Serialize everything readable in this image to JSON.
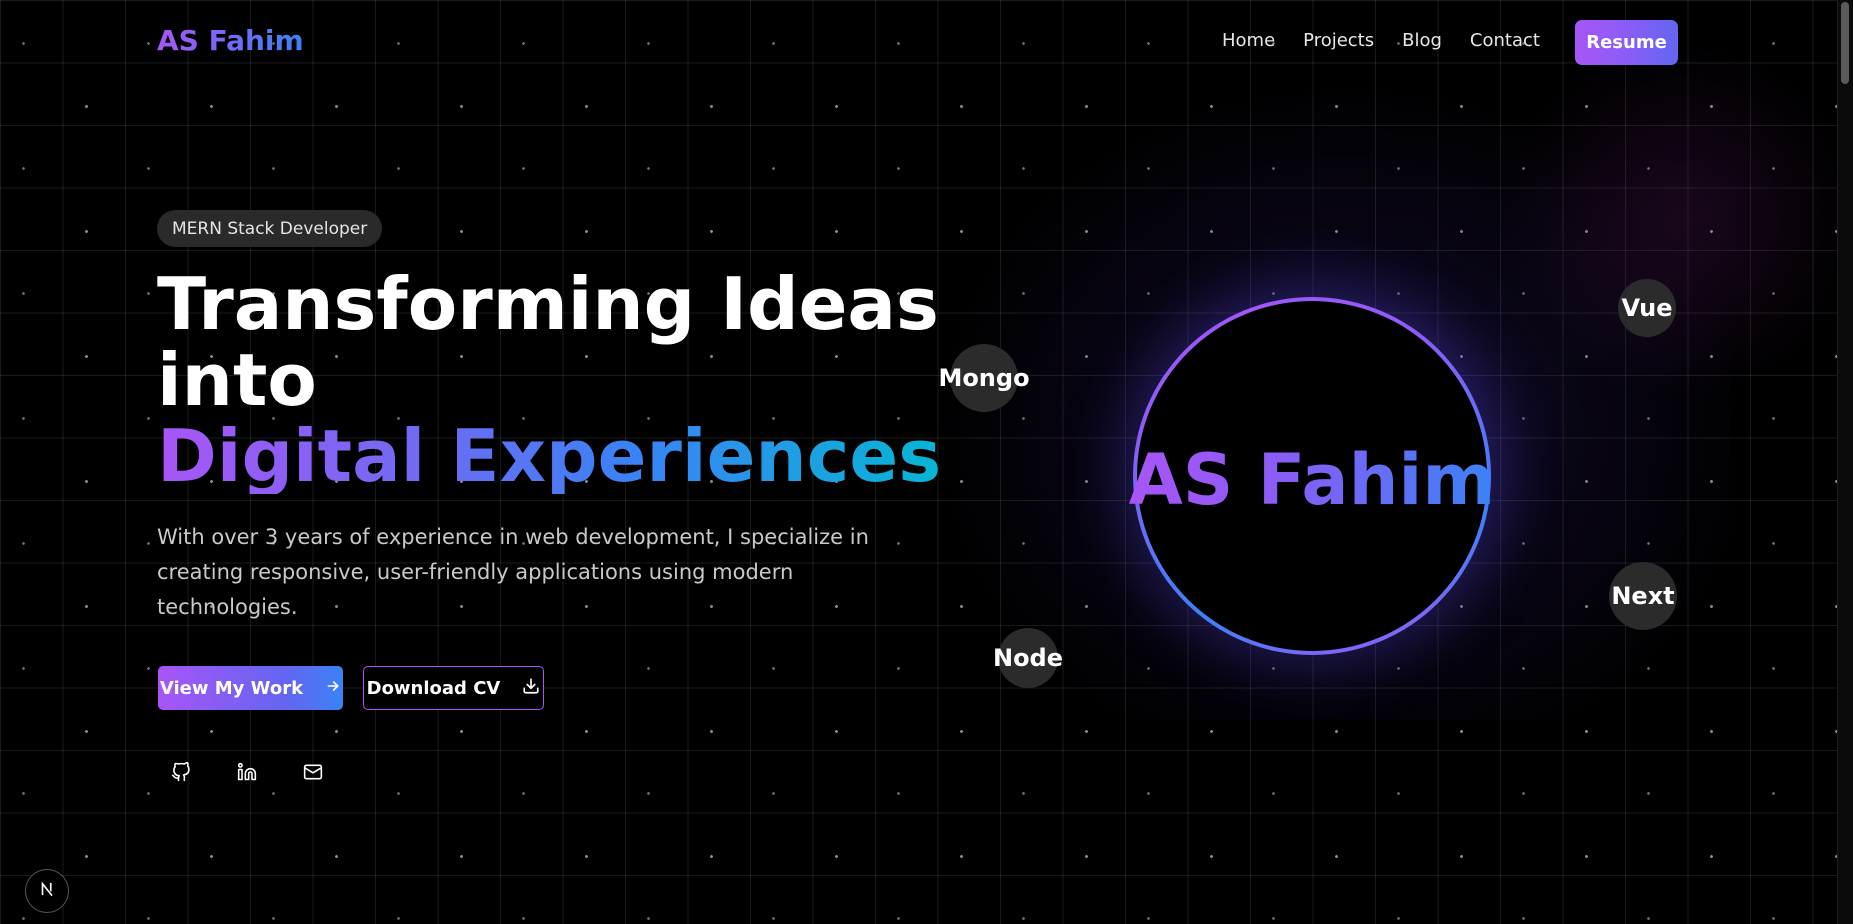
{
  "header": {
    "logo": "AS Fahim",
    "nav": [
      "Home",
      "Projects",
      "Blog",
      "Contact"
    ],
    "resume_label": "Resume"
  },
  "hero": {
    "badge": "MERN Stack Developer",
    "headline_line1": "Transforming Ideas",
    "headline_line2": "into",
    "headline_gradient": "Digital Experiences",
    "description": "With over 3 years of experience in web development, I specialize in creating responsive, user-friendly applications using modern technologies.",
    "primary_button": "View My Work",
    "secondary_button": "Download CV",
    "socials": [
      "github-icon",
      "linkedin-icon",
      "mail-icon"
    ]
  },
  "visual": {
    "circle_text": "AS Fahim",
    "tech": [
      "Mongo",
      "Node",
      "Vue",
      "Next"
    ]
  },
  "colors": {
    "accent_purple": "#a855f7",
    "accent_blue": "#3b82f6",
    "accent_cyan": "#06b6d4",
    "background": "#000000"
  }
}
